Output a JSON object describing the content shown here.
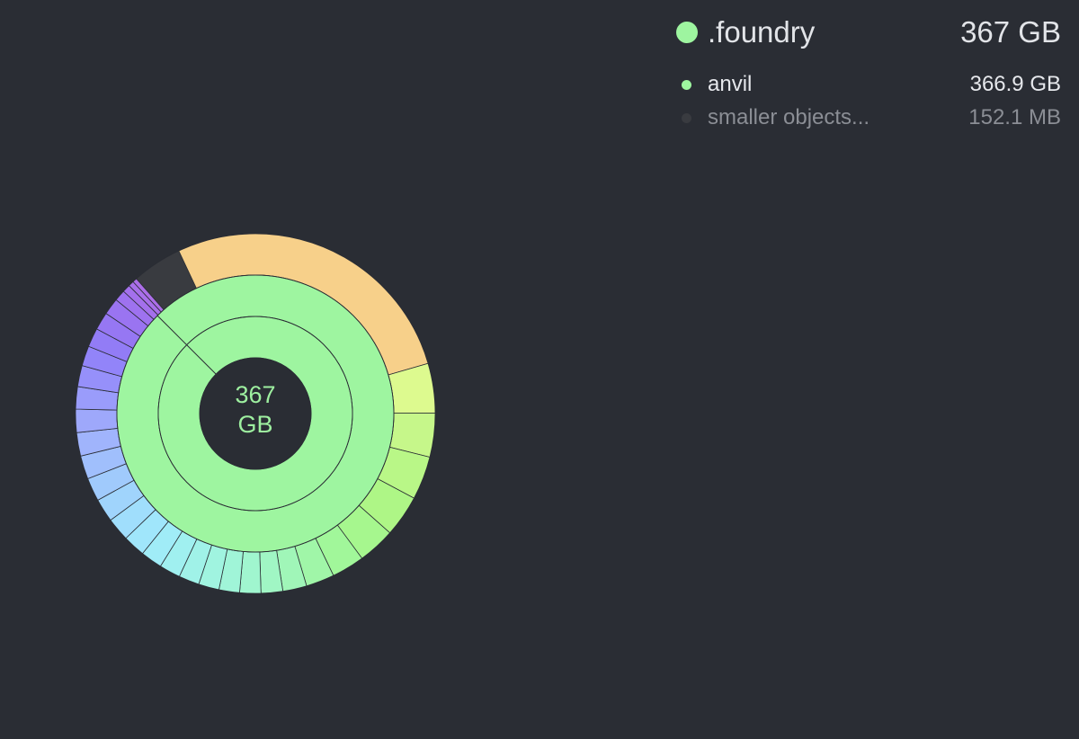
{
  "colors": {
    "background": "#2a2d34",
    "root_green": "#9ef5a0",
    "large_file_orange": "#f7d08a",
    "smaller_objects_gray": "#393b40",
    "center_text": "#9ef0a0"
  },
  "chart_data": {
    "type": "sunburst",
    "center_label": "367\nGB",
    "root": {
      "name": ".foundry",
      "size": "367 GB",
      "fraction": 1.0
    },
    "rings": [
      {
        "level": 1,
        "segments": [
          {
            "name": "anvil",
            "fraction": 1.0,
            "color": "#9ef5a0"
          }
        ]
      },
      {
        "level": 2,
        "segments": [
          {
            "name": "anvil",
            "fraction": 1.0,
            "color": "#9ef5a0"
          }
        ]
      },
      {
        "level": 3,
        "note_fraction_unit": "share of 367 GB",
        "segments": [
          {
            "fraction": 0.33,
            "color": "#f7d08a"
          },
          {
            "fraction": 0.0445,
            "color": "#ddfa8f"
          },
          {
            "fraction": 0.0395,
            "color": "#c6f78a"
          },
          {
            "fraction": 0.039,
            "color": "#b9f787"
          },
          {
            "fraction": 0.0375,
            "color": "#aef686"
          },
          {
            "fraction": 0.0335,
            "color": "#a6f78e"
          },
          {
            "fraction": 0.0295,
            "color": "#a1f79a"
          },
          {
            "fraction": 0.0255,
            "color": "#a0f6a8"
          },
          {
            "fraction": 0.0215,
            "color": "#a0f6b8"
          },
          {
            "fraction": 0.0195,
            "color": "#a0f6c4"
          },
          {
            "fraction": 0.019,
            "color": "#a0f6cf"
          },
          {
            "fraction": 0.0185,
            "color": "#a0f5d8"
          },
          {
            "fraction": 0.0185,
            "color": "#a0f4e0"
          },
          {
            "fraction": 0.0185,
            "color": "#a0f2e8"
          },
          {
            "fraction": 0.019,
            "color": "#a0f0f0"
          },
          {
            "fraction": 0.0195,
            "color": "#a0ecf7"
          },
          {
            "fraction": 0.02,
            "color": "#a0e6fb"
          },
          {
            "fraction": 0.021,
            "color": "#a0defc"
          },
          {
            "fraction": 0.021,
            "color": "#a0d4fc"
          },
          {
            "fraction": 0.021,
            "color": "#a0cafc"
          },
          {
            "fraction": 0.021,
            "color": "#a0bffc"
          },
          {
            "fraction": 0.021,
            "color": "#a0b4fc"
          },
          {
            "fraction": 0.021,
            "color": "#9ea8fb"
          },
          {
            "fraction": 0.02,
            "color": "#9a9cfb"
          },
          {
            "fraction": 0.019,
            "color": "#9690fa"
          },
          {
            "fraction": 0.018,
            "color": "#9284f9"
          },
          {
            "fraction": 0.017,
            "color": "#927cf6"
          },
          {
            "fraction": 0.016,
            "color": "#9677f3"
          },
          {
            "fraction": 0.015,
            "color": "#9a74f1"
          },
          {
            "fraction": 0.01,
            "color": "#9e72ef"
          },
          {
            "fraction": 0.007,
            "color": "#a470ec"
          },
          {
            "fraction": 0.005,
            "color": "#a86fea"
          },
          {
            "fraction": 0.004,
            "color": "#ac6ee8"
          },
          {
            "fraction": 0.045,
            "color": "#393b40",
            "name": "smaller objects..."
          }
        ]
      }
    ]
  },
  "legend": {
    "root": {
      "name": ".foundry",
      "size": "367 GB",
      "color": "#9ef5a0"
    },
    "items": [
      {
        "name": "anvil",
        "size": "366.9 GB",
        "color": "#9ef5a0"
      },
      {
        "name": "smaller objects...",
        "size": "152.1  MB",
        "color": "#393b40"
      }
    ]
  }
}
